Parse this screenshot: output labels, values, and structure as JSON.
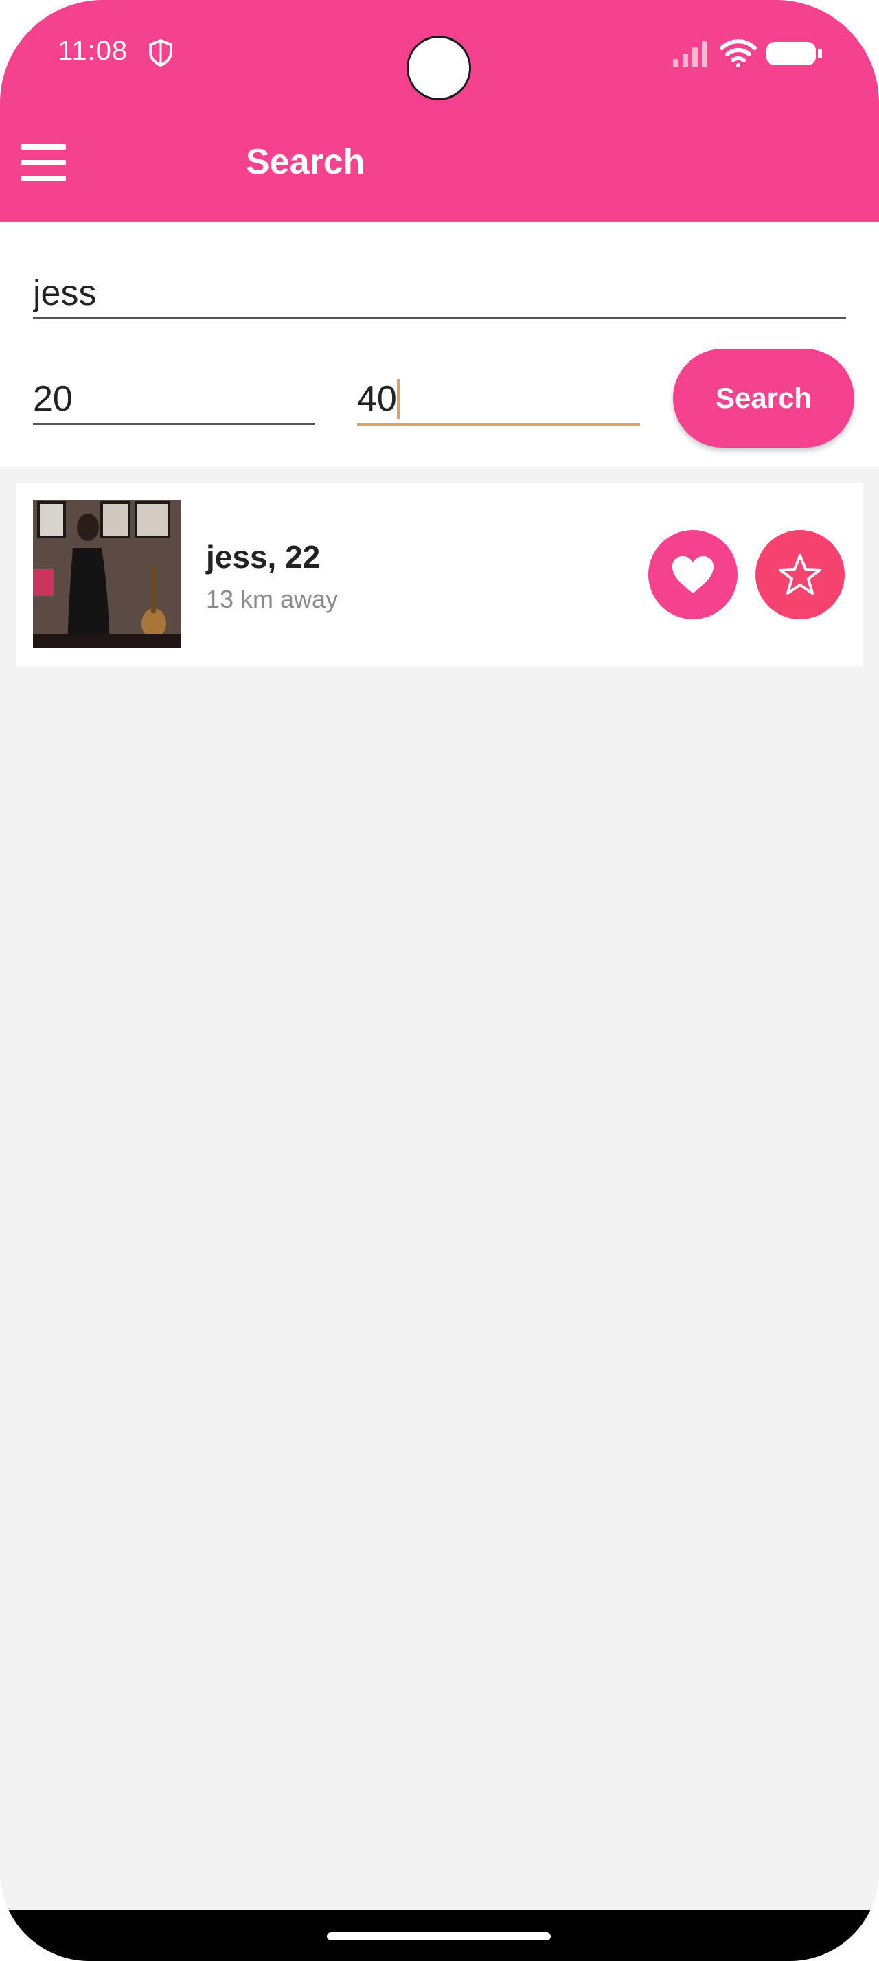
{
  "status_bar": {
    "time": "11:08",
    "icons": [
      "shield-icon",
      "signal-icon",
      "wifi-icon",
      "battery-icon"
    ]
  },
  "app_bar": {
    "title": "Search",
    "menu_icon": "menu-icon"
  },
  "search_form": {
    "name_value": "jess",
    "min_age_value": "20",
    "max_age_value": "40",
    "search_button_label": "Search"
  },
  "results": [
    {
      "name_age": "jess, 22",
      "distance": "13 km away",
      "actions": [
        "heart-icon",
        "star-icon"
      ]
    }
  ],
  "colors": {
    "primary": "#f4428f",
    "accent": "#dca06a",
    "background": "#f3f3f3"
  }
}
